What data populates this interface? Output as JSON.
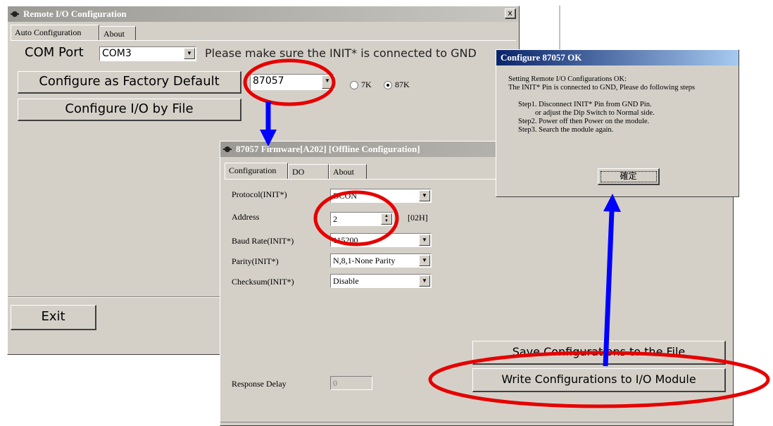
{
  "main_window": {
    "title": "Remote I/O Configuration",
    "close_label": "x",
    "tabs": [
      "Auto Configuration",
      "About"
    ],
    "com_port_label": "COM Port",
    "com_port_value": "COM3",
    "notice": "Please make sure the INIT* is connected to GND",
    "factory_button": "Configure as Factory Default",
    "module_value": "87057",
    "radio_7k": "7K",
    "radio_87k": "87K",
    "selected_radio": "87K",
    "file_button": "Configure I/O by File",
    "exit_button": "Exit"
  },
  "firmware_window": {
    "title": "87057 Firmware[A202] [Offline Configuration]",
    "tabs": [
      "Configuration",
      "DO",
      "About"
    ],
    "protocol_label": "Protocol(INIT*)",
    "protocol_value": "DCON",
    "address_label": "Address",
    "address_value": "2",
    "address_hex": "[02H]",
    "baud_label": "Baud Rate(INIT*)",
    "baud_value": "115200",
    "parity_label": "Parity(INIT*)",
    "parity_value": "N,8,1-None Parity",
    "checksum_label": "Checksum(INIT*)",
    "checksum_value": "Disable",
    "response_label": "Response Delay",
    "response_value": "0",
    "save_button": "Save Configurations to the File",
    "write_button": "Write Configurations to I/O Module"
  },
  "ok_dialog": {
    "title": "Configure 87057 OK",
    "line1": "Setting Remote I/O Configurations OK:",
    "line2": "The INIT* Pin is connected to GND, Please do following steps",
    "step1": "Step1. Disconnect INIT* Pin from GND Pin.",
    "step1b": "or adjust the Dip Switch to Normal side.",
    "step2": "Step2. Power off then Power on the module.",
    "step3": "Step3. Search the module again.",
    "ok_button": "確定"
  },
  "colors": {
    "highlight_ring": "#e60000",
    "arrow": "#0000ff",
    "titlebar_active": "#0a246a"
  }
}
